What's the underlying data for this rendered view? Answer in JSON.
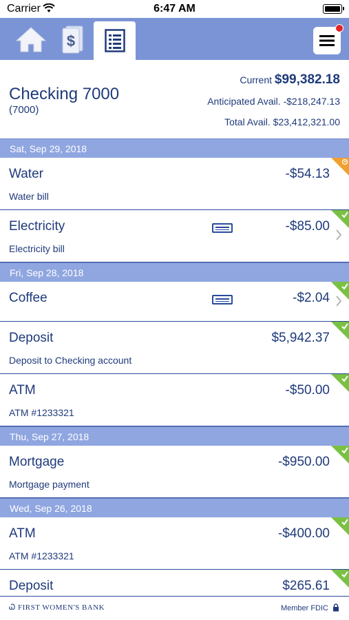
{
  "status_bar": {
    "carrier": "Carrier",
    "time": "6:47 AM"
  },
  "nav": {
    "tabs": [
      {
        "name": "home",
        "icon": "home-icon"
      },
      {
        "name": "money",
        "icon": "dollar-document-icon"
      },
      {
        "name": "statement",
        "icon": "statement-icon",
        "active": true
      }
    ],
    "menu_icon": "hamburger-menu-icon",
    "has_notification": true
  },
  "account": {
    "name": "Checking 7000",
    "number": "(7000)",
    "current_label": "Current",
    "current_amount": "$99,382.18",
    "anticipated": "Anticipated Avail. -$218,247.13",
    "total": "Total Avail. $23,412,321.00"
  },
  "groups": [
    {
      "date": "Sat, Sep 29, 2018",
      "transactions": [
        {
          "name": "Water",
          "description": "Water bill",
          "amount": "-$54.13",
          "status": "pending",
          "card": false,
          "chevron": false
        },
        {
          "name": "Electricity",
          "description": "Electricity bill",
          "amount": "-$85.00",
          "status": "cleared",
          "card": true,
          "chevron": true
        }
      ]
    },
    {
      "date": "Fri, Sep 28, 2018",
      "transactions": [
        {
          "name": "Coffee",
          "description": "",
          "amount": "-$2.04",
          "status": "cleared",
          "card": true,
          "chevron": true
        },
        {
          "name": "Deposit",
          "description": "Deposit to Checking account",
          "amount": "$5,942.37",
          "status": "cleared",
          "card": false,
          "chevron": false
        },
        {
          "name": "ATM",
          "description": "ATM #1233321",
          "amount": "-$50.00",
          "status": "cleared",
          "card": false,
          "chevron": false
        }
      ]
    },
    {
      "date": "Thu, Sep 27, 2018",
      "transactions": [
        {
          "name": "Mortgage",
          "description": "Mortgage payment",
          "amount": "-$950.00",
          "status": "cleared",
          "card": false,
          "chevron": false
        }
      ]
    },
    {
      "date": "Wed, Sep 26, 2018",
      "transactions": [
        {
          "name": "ATM",
          "description": "ATM #1233321",
          "amount": "-$400.00",
          "status": "cleared",
          "card": false,
          "chevron": false
        },
        {
          "name": "Deposit",
          "description": "",
          "amount": "$265.61",
          "status": "cleared",
          "card": false,
          "chevron": false
        }
      ]
    }
  ],
  "footer": {
    "bank_name": "FIRST WOMEN'S BANK",
    "member": "Member FDIC"
  },
  "colors": {
    "navy": "#1f3a7a",
    "nav_bg": "#7b94d6",
    "date_bg": "#8fa6e0",
    "cleared": "#7ac143",
    "pending": "#f0a030"
  }
}
